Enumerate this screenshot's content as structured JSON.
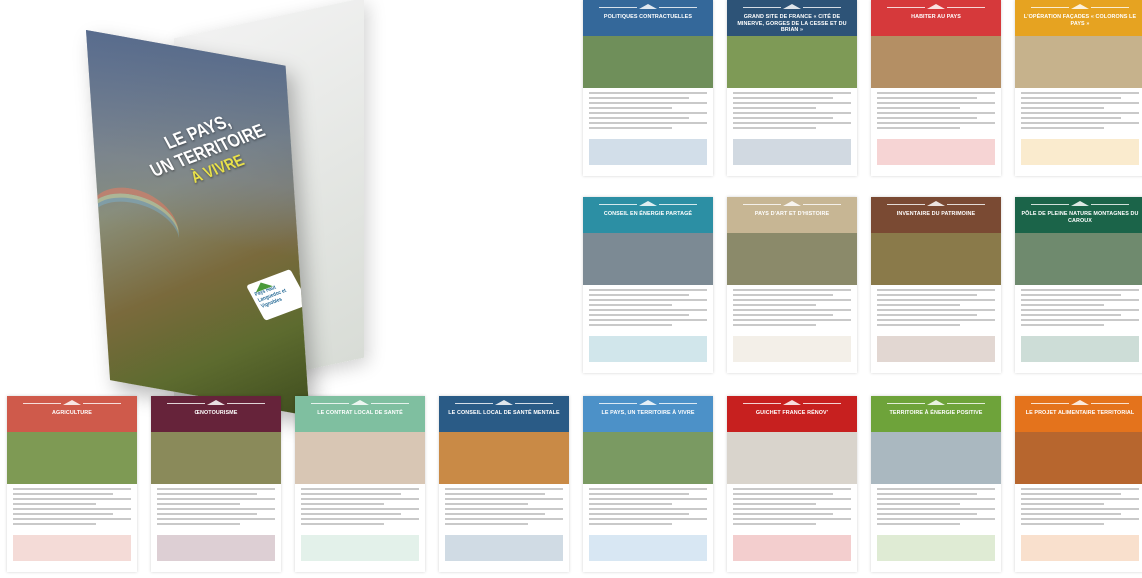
{
  "brochure": {
    "title_line1": "LE PAYS,",
    "title_line2": "UN TERRITOIRE",
    "title_line3": "À VIVRE",
    "logo_text": "Pays Haut Languedoc et Vignobles"
  },
  "colors": {
    "blue": "#34689a",
    "navy": "#2d5377",
    "red": "#d6393b",
    "yellow": "#e6a321",
    "teal": "#2c8fa4",
    "tan": "#c7b694",
    "brown": "#7a4a33",
    "darkgreen": "#1b6449",
    "coral": "#cf5a4b",
    "maroon": "#66233a",
    "mint": "#7fbfa0",
    "darkblue": "#2a5b86",
    "sky": "#4c91c8",
    "brightred": "#c7201f",
    "green": "#6ea33a",
    "orange": "#e4731c"
  },
  "panels": [
    {
      "title": "POLITIQUES CONTRACTUELLES",
      "color": "#34689a",
      "photo": "#6f8f5a"
    },
    {
      "title": "GRAND SITE DE FRANCE « CITÉ DE MINERVE, GORGES DE LA CESSE ET DU BRIAN »",
      "color": "#2d5377",
      "photo": "#7e9a56"
    },
    {
      "title": "HABITER AU PAYS",
      "color": "#d6393b",
      "photo": "#b48f64"
    },
    {
      "title": "L'OPÉRATION FAÇADES « COLORONS LE PAYS »",
      "color": "#e6a321",
      "photo": "#c6b28c"
    },
    {
      "title": "CONSEIL EN ÉNERGIE PARTAGÉ",
      "color": "#2c8fa4",
      "photo": "#7c8a94"
    },
    {
      "title": "PAYS D'ART ET D'HISTOIRE",
      "color": "#c7b694",
      "photo": "#8b8a6a"
    },
    {
      "title": "INVENTAIRE DU PATRIMOINE",
      "color": "#7a4a33",
      "photo": "#8a7a4a"
    },
    {
      "title": "PÔLE DE PLEINE NATURE MONTAGNES DU CAROUX",
      "color": "#1b6449",
      "photo": "#6f8a6e"
    },
    {
      "title": "AGRICULTURE",
      "color": "#cf5a4b",
      "photo": "#7e9a54"
    },
    {
      "title": "ŒNOTOURISME",
      "color": "#66233a",
      "photo": "#8a8a5a"
    },
    {
      "title": "LE CONTRAT LOCAL DE SANTÉ",
      "color": "#7fbfa0",
      "photo": "#d8c6b4"
    },
    {
      "title": "LE CONSEIL LOCAL DE SANTÉ MENTALE",
      "color": "#2a5b86",
      "photo": "#c98a46"
    },
    {
      "title": "LE PAYS, UN TERRITOIRE À VIVRE",
      "color": "#4c91c8",
      "photo": "#7a9a62"
    },
    {
      "title": "GUICHET FRANCE RÉNOV'",
      "color": "#c7201f",
      "photo": "#d9d4cc"
    },
    {
      "title": "TERRITOIRE À ÉNERGIE POSITIVE",
      "color": "#6ea33a",
      "photo": "#aab8c0"
    },
    {
      "title": "LE PROJET ALIMENTAIRE TERRITORIAL",
      "color": "#e4731c",
      "photo": "#b7662e"
    }
  ]
}
